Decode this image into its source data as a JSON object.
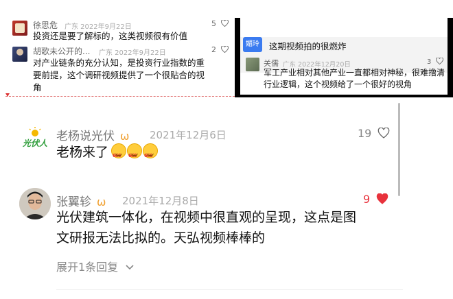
{
  "top_left": {
    "comments": [
      {
        "name": "徐思危",
        "location_date": "广东 2022年9月22日",
        "likes": "5",
        "body": "投资还是要了解标的，这类视频很有价值"
      },
      {
        "name": "胡歌未公开的...",
        "location_date": "广东 2022年9月22日",
        "likes": "2",
        "body": "对产业链条的充分认知，是投资行业指数的重要前提，这个调研视频提供了一个很贴合的视角"
      }
    ]
  },
  "top_right": {
    "tag": "媚玲",
    "title": "这期视频拍的很燃炸",
    "comment": {
      "name": "关儒",
      "location_date": "广东 2022年12月20日",
      "likes": "3",
      "body": "军工产业相对其他产业一直都相对神秘，很难撸清行业逻辑，这个视频给了一个很好的视角"
    }
  },
  "main": {
    "comments": [
      {
        "name": "老杨说光伏",
        "badge": "ѡ",
        "date": "2021年12月6日",
        "likes": "19",
        "liked": false,
        "body": "老杨来了",
        "emoji_count": 3,
        "avatar_text": "光伏人"
      },
      {
        "name": "张翼轸",
        "badge": "ѡ",
        "date": "2021年12月8日",
        "likes": "9",
        "liked": true,
        "body_line1": "光伏建筑一体化，在视频中很直观的呈现，这点是图",
        "body_line2": "文研报无法比拟的。天弘视频棒棒的"
      }
    ],
    "expand_label": "展开1条回复"
  },
  "colors": {
    "heart_red": "#e8323c",
    "badge_orange": "#f0a030",
    "tag_blue": "#3b7bf0"
  }
}
